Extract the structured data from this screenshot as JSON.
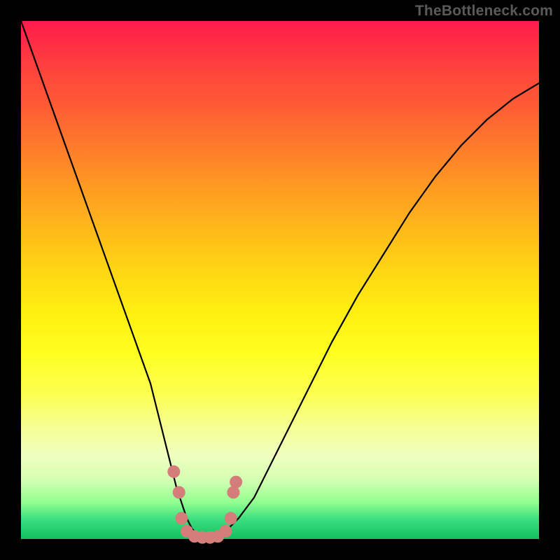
{
  "watermark": "TheBottleneck.com",
  "chart_data": {
    "type": "line",
    "title": "",
    "xlabel": "",
    "ylabel": "",
    "xlim": [
      0,
      100
    ],
    "ylim": [
      0,
      100
    ],
    "series": [
      {
        "name": "bottleneck-curve",
        "x": [
          0,
          5,
          10,
          15,
          20,
          25,
          28,
          30,
          32,
          33,
          34,
          35,
          36,
          38,
          40,
          42,
          45,
          50,
          55,
          60,
          65,
          70,
          75,
          80,
          85,
          90,
          95,
          100
        ],
        "values": [
          100,
          86,
          72,
          58,
          44,
          30,
          18,
          10,
          4,
          2,
          1,
          0,
          0,
          1,
          2,
          4,
          8,
          18,
          28,
          38,
          47,
          55,
          63,
          70,
          76,
          81,
          85,
          88
        ]
      }
    ],
    "markers": {
      "name": "red-dots",
      "color": "#d47d7a",
      "points": [
        {
          "x": 29.5,
          "y": 13
        },
        {
          "x": 30.5,
          "y": 9
        },
        {
          "x": 31,
          "y": 4
        },
        {
          "x": 32,
          "y": 1.5
        },
        {
          "x": 33.5,
          "y": 0.5
        },
        {
          "x": 35,
          "y": 0.3
        },
        {
          "x": 36.5,
          "y": 0.3
        },
        {
          "x": 38,
          "y": 0.5
        },
        {
          "x": 39.5,
          "y": 1.5
        },
        {
          "x": 40.5,
          "y": 4
        },
        {
          "x": 41,
          "y": 9
        },
        {
          "x": 41.5,
          "y": 11
        }
      ]
    },
    "background": {
      "type": "vertical-gradient",
      "stops": [
        {
          "pos": 0,
          "color": "#ff1a4d"
        },
        {
          "pos": 50,
          "color": "#ffee10"
        },
        {
          "pos": 100,
          "color": "#10c060"
        }
      ]
    }
  }
}
